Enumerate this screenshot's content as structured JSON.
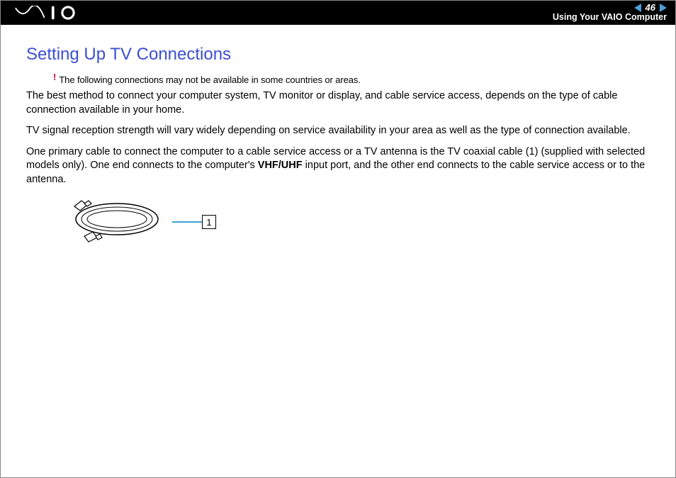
{
  "header": {
    "page_number": "46",
    "section": "Using Your VAIO Computer"
  },
  "title": "Setting Up TV Connections",
  "warning": {
    "mark": "!",
    "text": "The following connections may not be available in some countries or areas."
  },
  "paragraphs": {
    "p1": "The best method to connect your computer system, TV monitor or display, and cable service access, depends on the type of cable connection available in your home.",
    "p2": "TV signal reception strength will vary widely depending on service availability in your area as well as the type of connection available.",
    "p3a": "One primary cable to connect the computer to a cable service access or a TV antenna is the TV coaxial cable (1) (supplied with selected models only). One end connects to the computer's ",
    "p3b": "VHF/UHF",
    "p3c": " input port, and the other end connects to the cable service access or to the antenna."
  },
  "illustration": {
    "callout_number": "1"
  }
}
